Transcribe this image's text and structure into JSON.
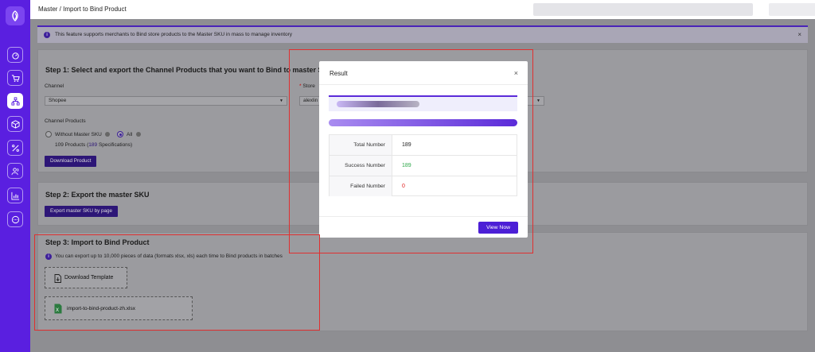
{
  "breadcrumb": "Master / Import to Bind Product",
  "notice": {
    "text": "This feature supports merchants to Bind store products to the Master SKU in mass to manage inventory",
    "close": "×",
    "info_icon": "info-icon"
  },
  "step1": {
    "title": "Step 1: Select and export the Channel Products that you want to Bind to master SKU",
    "channel_label": "Channel",
    "channel_value": "Shopee",
    "store_required": "*",
    "store_label": "Store",
    "store_value": "alexlin",
    "channel_products_label": "Channel Products",
    "radio_without": "Without Master SKU",
    "radio_all": "All",
    "summary_prefix": "109 Products (",
    "summary_count": "189",
    "summary_suffix": " Specifications)",
    "download_button": "Download Product"
  },
  "step2": {
    "title": "Step 2: Export the master SKU",
    "export_button": "Export master SKU by page"
  },
  "step3": {
    "title": "Step 3: Import to Bind Product",
    "hint": "You can export up to 10,000 pieces of data (formats xlsx, xls) each time to Bind products in batches",
    "download_template": "Download Template",
    "file_name": "import-to-bind-product-zh.xlsx"
  },
  "modal": {
    "title": "Result",
    "close": "×",
    "progress": 1.0,
    "rows": [
      {
        "label": "Total Number",
        "value": "189",
        "color": "#222222"
      },
      {
        "label": "Success Number",
        "value": "189",
        "color": "#2ea84a"
      },
      {
        "label": "Failed Number",
        "value": "0",
        "color": "#e02020"
      }
    ],
    "view_button": "View Now"
  },
  "colors": {
    "sidebar": "#5a1fe0",
    "primary": "#4c1fd6",
    "annotation": "#e03030"
  }
}
